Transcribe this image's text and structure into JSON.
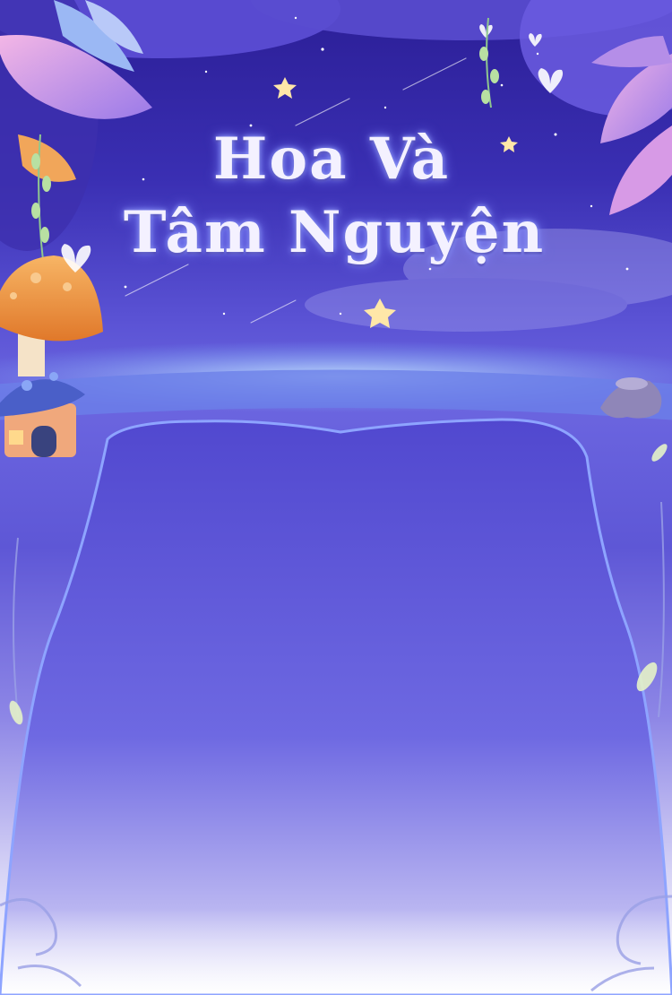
{
  "title": {
    "line1": "Hoa Và",
    "line2": "Tâm Nguyện"
  },
  "colors": {
    "sky_top": "#2b1e96",
    "panel": "#5a52d6",
    "glow": "#7fb4ff",
    "mushroom_cap": "#f29a3a",
    "title_text": "#f4f1ff"
  }
}
